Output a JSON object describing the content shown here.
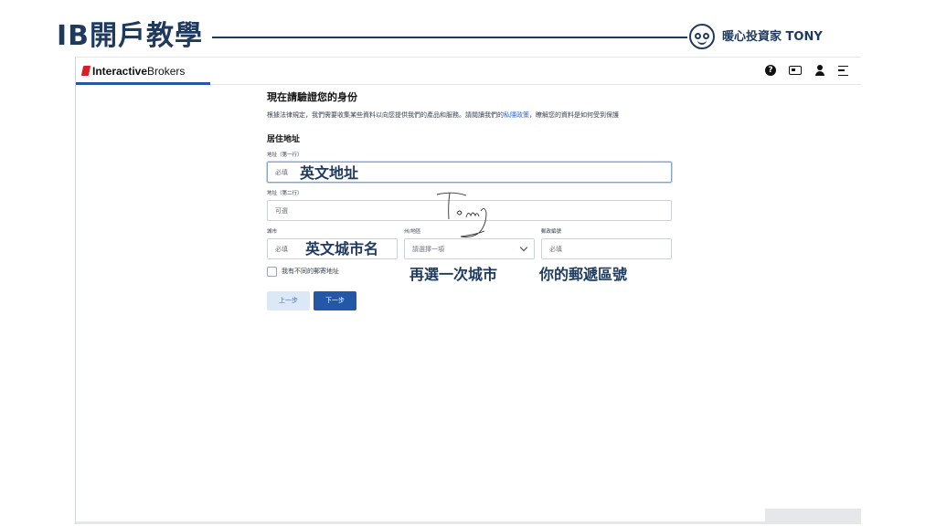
{
  "slide": {
    "title": "IB開戶教學",
    "brand": "暖心投資家 TONY"
  },
  "app": {
    "logo_mark": "Interactive",
    "logo_rest": "Brokers",
    "header_icons": [
      "help-icon",
      "id-card-icon",
      "user-icon",
      "menu-icon"
    ],
    "help_glyph": "?"
  },
  "form": {
    "heading": "現在請驗證您的身份",
    "description_pre": "根據法律規定，我們需要收集某些資料以向您提供我們的產品和服務。請閱讀我們的",
    "privacy_link": "私隱政策",
    "description_post": "，瞭解您的資料是如何受到保護",
    "section_title": "居住地址",
    "address1": {
      "label": "地址（第一行）",
      "placeholder": "必填"
    },
    "address2": {
      "label": "地址（第二行）",
      "placeholder": "可選"
    },
    "city": {
      "label": "城市",
      "placeholder": "必填"
    },
    "state": {
      "label": "州/地區",
      "placeholder": "請選擇一項"
    },
    "postal": {
      "label": "郵政編號",
      "placeholder": "必填"
    },
    "mailing_checkbox_label": "我有不同的郵寄地址",
    "mailing_checked": false,
    "prev_button": "上一步",
    "next_button": "下一步"
  },
  "annotations": {
    "address": "英文地址",
    "city": "英文城市名",
    "state": "再選一次城市",
    "postal": "你的郵遞區號"
  },
  "colors": {
    "accent": "#2457a6",
    "slide_title": "#1e3a5f",
    "logo_red": "#d81f26"
  }
}
